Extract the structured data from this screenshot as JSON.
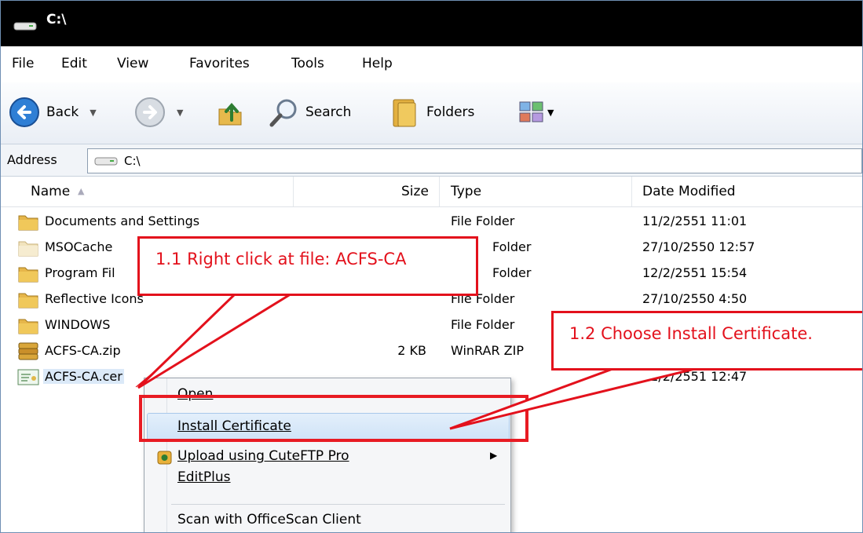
{
  "window": {
    "title": "C:\\"
  },
  "menu": [
    "File",
    "Edit",
    "View",
    "Favorites",
    "Tools",
    "Help"
  ],
  "toolbar": {
    "back": "Back",
    "search": "Search",
    "folders": "Folders"
  },
  "address": {
    "label": "Address",
    "value": "C:\\"
  },
  "columns": {
    "name": "Name",
    "size": "Size",
    "type": "Type",
    "date": "Date Modified"
  },
  "files": [
    {
      "name": "Documents and Settings",
      "size": "",
      "type": "File Folder",
      "date": "11/2/2551 11:01"
    },
    {
      "name": "MSOCache",
      "size": "",
      "type": "Folder",
      "date": "27/10/2550 12:57"
    },
    {
      "name": "Program Fil",
      "size": "",
      "type": "Folder",
      "date": "12/2/2551 15:54"
    },
    {
      "name": "Reflective Icons",
      "size": "",
      "type": "File Folder",
      "date": "27/10/2550 4:50"
    },
    {
      "name": "WINDOWS",
      "size": "",
      "type": "File Folder",
      "date": ""
    },
    {
      "name": "ACFS-CA.zip",
      "size": "2 KB",
      "type": "WinRAR ZIP",
      "date": ""
    },
    {
      "name": "ACFS-CA.cer",
      "size": "",
      "type": "",
      "date": "11/2/2551 12:47"
    }
  ],
  "context_menu": {
    "open": "Open",
    "install": "Install Certificate",
    "upload": "Upload using CuteFTP Pro",
    "editplus": "EditPlus",
    "scan": "Scan with OfficeScan Client"
  },
  "callouts": {
    "step1": "1.1 Right click at file: ACFS-CA",
    "step2": "1.2 Choose Install Certificate."
  },
  "colors": {
    "annotation": "#e3111c",
    "highlight": "#cfe3f7",
    "titlebar": "#000000"
  }
}
